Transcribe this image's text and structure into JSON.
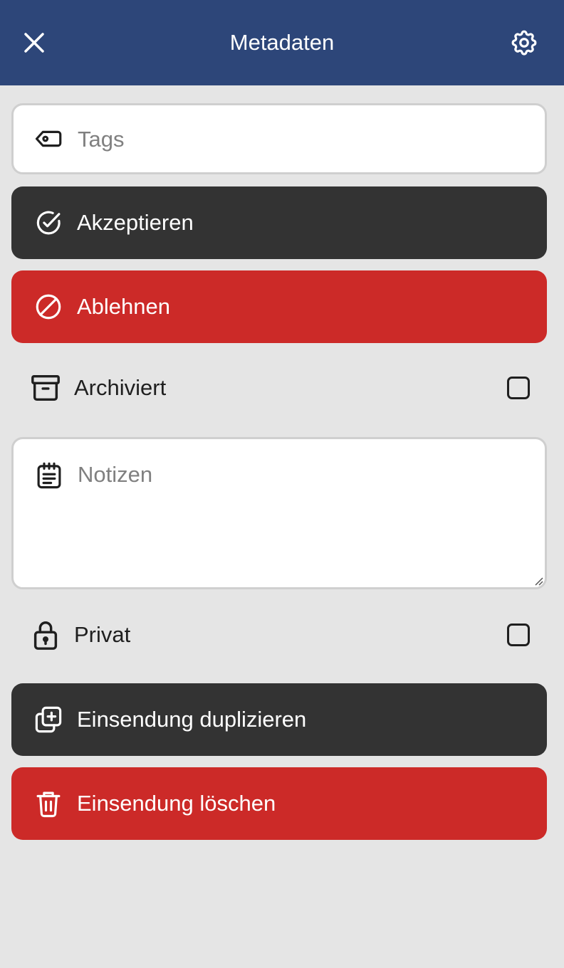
{
  "header": {
    "title": "Metadaten",
    "close_icon": "close-icon",
    "settings_icon": "gear-icon",
    "background_color": "#2d4679"
  },
  "tags_field": {
    "placeholder": "Tags",
    "value": "",
    "icon": "tag-icon"
  },
  "accept_button": {
    "label": "Akzeptieren",
    "icon": "check-circle-icon",
    "color": "#333333"
  },
  "reject_button": {
    "label": "Ablehnen",
    "icon": "ban-icon",
    "color": "#cc2a28"
  },
  "archived_row": {
    "label": "Archiviert",
    "icon": "archive-icon",
    "checked": false
  },
  "notes_field": {
    "placeholder": "Notizen",
    "value": "",
    "icon": "notes-icon"
  },
  "private_row": {
    "label": "Privat",
    "icon": "lock-icon",
    "checked": false
  },
  "duplicate_button": {
    "label": "Einsendung duplizieren",
    "icon": "duplicate-icon",
    "color": "#333333"
  },
  "delete_button": {
    "label": "Einsendung löschen",
    "icon": "trash-icon",
    "color": "#cc2a28"
  }
}
